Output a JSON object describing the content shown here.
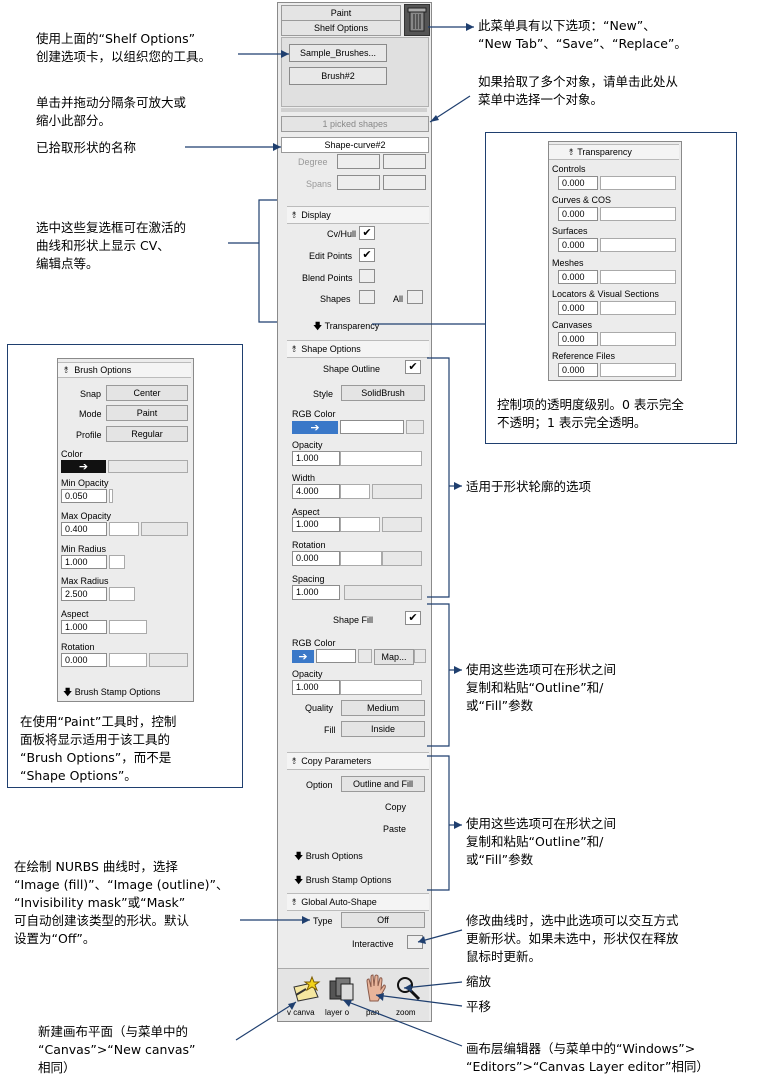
{
  "shelf": {
    "paint_label": "Paint",
    "shelf_options_label": "Shelf Options",
    "tab1": "Sample_Brushes...",
    "tab2": "Brush#2",
    "picked": "1 picked shapes"
  },
  "shape_info": {
    "name": "Shape-curve#2",
    "degree_label": "Degree",
    "spans_label": "Spans"
  },
  "display": {
    "header": "Display",
    "cv_hull": "Cv/Hull",
    "edit_points": "Edit Points",
    "blend_points": "Blend Points",
    "shapes": "Shapes",
    "all": "All",
    "transparency": "Transparency"
  },
  "shape_options": {
    "header": "Shape Options",
    "shape_outline": "Shape Outline",
    "style_label": "Style",
    "style_value": "SolidBrush",
    "rgb_label": "RGB Color",
    "opacity_label": "Opacity",
    "opacity_value": "1.000",
    "width_label": "Width",
    "width_value": "4.000",
    "aspect_label": "Aspect",
    "aspect_value": "1.000",
    "rotation_label": "Rotation",
    "rotation_value": "0.000",
    "spacing_label": "Spacing",
    "spacing_value": "1.000",
    "shape_fill": "Shape Fill",
    "rgb2_label": "RGB Color",
    "map_label": "Map...",
    "opacity2_label": "Opacity",
    "opacity2_value": "1.000",
    "quality_label": "Quality",
    "quality_value": "Medium",
    "fill_label": "Fill",
    "fill_value": "Inside"
  },
  "copy_params": {
    "header": "Copy Parameters",
    "option_label": "Option",
    "option_value": "Outline and Fill",
    "copy": "Copy",
    "paste": "Paste",
    "brush_options": "Brush Options",
    "brush_stamp": "Brush Stamp Options"
  },
  "auto_shape": {
    "header": "Global Auto-Shape",
    "type_label": "Type",
    "type_value": "Off",
    "interactive": "Interactive"
  },
  "bottom_tools": {
    "label1": "v canva",
    "label2": "layer o",
    "label3": "pan",
    "label4": "zoom"
  },
  "transparency_panel": {
    "header": "Transparency",
    "items": [
      {
        "label": "Controls",
        "value": "0.000"
      },
      {
        "label": "Curves & COS",
        "value": "0.000"
      },
      {
        "label": "Surfaces",
        "value": "0.000"
      },
      {
        "label": "Meshes",
        "value": "0.000"
      },
      {
        "label": "Locators & Visual Sections",
        "value": "0.000"
      },
      {
        "label": "Canvases",
        "value": "0.000"
      },
      {
        "label": "Reference Files",
        "value": "0.000"
      }
    ]
  },
  "brush_panel": {
    "header": "Brush Options",
    "snap_label": "Snap",
    "snap_value": "Center",
    "mode_label": "Mode",
    "mode_value": "Paint",
    "profile_label": "Profile",
    "profile_value": "Regular",
    "color_label": "Color",
    "min_opacity_label": "Min Opacity",
    "min_opacity_value": "0.050",
    "max_opacity_label": "Max Opacity",
    "max_opacity_value": "0.400",
    "min_radius_label": "Min Radius",
    "min_radius_value": "1.000",
    "max_radius_label": "Max Radius",
    "max_radius_value": "2.500",
    "aspect_label": "Aspect",
    "aspect_value": "1.000",
    "rotation_label": "Rotation",
    "rotation_value": "0.000",
    "stamp_label": "Brush Stamp Options"
  },
  "callouts": {
    "c1": "使用上面的“Shelf Options”\n创建选项卡，以组织您的工具。",
    "c2": "单击并拖动分隔条可放大或\n缩小此部分。",
    "c3": "已拾取形状的名称",
    "c4": "选中这些复选框可在激活的\n曲线和形状上显示 CV、\n编辑点等。",
    "c5": "此菜单具有以下选项：“New”、\n“New Tab”、“Save”、“Replace”。",
    "c6": "如果拾取了多个对象，请单击此处从\n菜单中选择一个对象。",
    "c7": "控制项的透明度级别。0 表示完全\n不透明；1 表示完全透明。",
    "c8": "适用于形状轮廓的选项",
    "c9": "使用这些选项可在形状之间\n复制和粘贴“Outline”和/\n或“Fill”参数",
    "c10": "在使用“Paint”工具时，控制\n面板将显示适用于该工具的\n“Brush Options”，而不是\n“Shape Options”。",
    "c11": "使用这些选项可在形状之间\n复制和粘贴“Outline”和/\n或“Fill”参数",
    "c12": "在绘制 NURBS 曲线时，选择\n“Image (fill)”、“Image (outline)”、\n“Invisibility mask”或“Mask”\n可自动创建该类型的形状。默认\n设置为“Off”。",
    "c13": "修改曲线时，选中此选项可以交互方式\n更新形状。如果未选中，形状仅在释放\n鼠标时更新。",
    "c14": "缩放",
    "c15": "平移",
    "c16": "新建画布平面（与菜单中的\n“Canvas”>“New canvas”\n相同）",
    "c17": "画布层编辑器（与菜单中的“Windows”>\n“Editors”>“Canvas Layer editor”相同）"
  }
}
